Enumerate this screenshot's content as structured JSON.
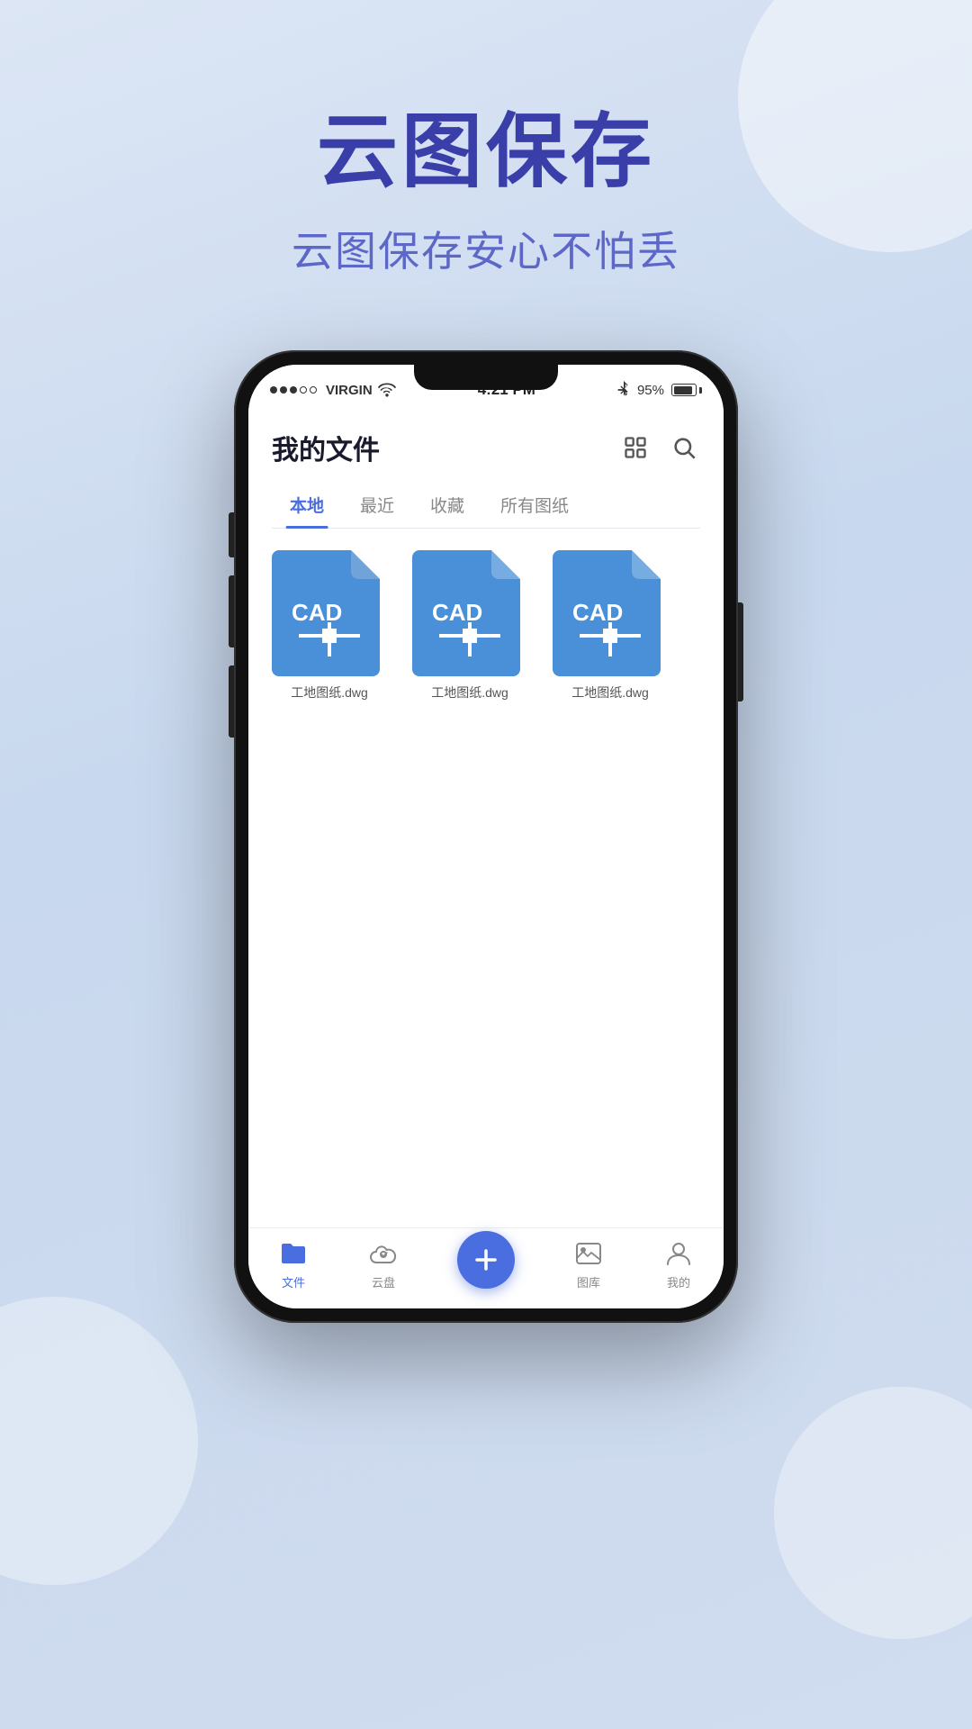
{
  "background": {
    "gradient_start": "#dce6f5",
    "gradient_end": "#c8d8ee"
  },
  "hero": {
    "title": "云图保存",
    "subtitle": "云图保存安心不怕丢"
  },
  "status_bar": {
    "carrier": "VIRGIN",
    "wifi": true,
    "time": "4:21 PM",
    "bluetooth": true,
    "battery": "95%"
  },
  "app_header": {
    "title": "我的文件",
    "grid_icon": "grid-icon",
    "search_icon": "search-icon"
  },
  "tabs": [
    {
      "label": "本地",
      "active": true
    },
    {
      "label": "最近",
      "active": false
    },
    {
      "label": "收藏",
      "active": false
    },
    {
      "label": "所有图纸",
      "active": false
    }
  ],
  "files": [
    {
      "name": "工地图纸.dwg",
      "type": "CAD"
    },
    {
      "name": "工地图纸.dwg",
      "type": "CAD"
    },
    {
      "name": "工地图纸.dwg",
      "type": "CAD"
    }
  ],
  "bottom_nav": [
    {
      "label": "文件",
      "icon": "folder-icon",
      "active": true
    },
    {
      "label": "云盘",
      "icon": "cloud-icon",
      "active": false
    },
    {
      "label": "",
      "icon": "add-icon",
      "active": false,
      "is_add": true
    },
    {
      "label": "图库",
      "icon": "gallery-icon",
      "active": false
    },
    {
      "label": "我的",
      "icon": "user-icon",
      "active": false
    }
  ]
}
